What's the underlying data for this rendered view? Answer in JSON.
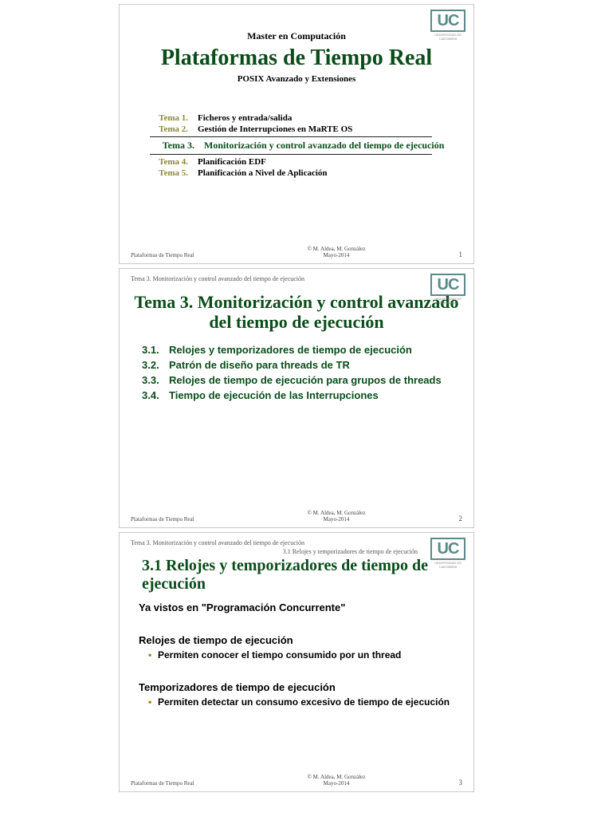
{
  "common": {
    "logo_text": "UC",
    "logo_sub": "UNIVERSIDAD DE CANTABRIA",
    "footer_left": "Plataformas de Tiempo Real",
    "footer_center1": "© M. Aldea, M. González",
    "footer_center2": "Mayo-2014"
  },
  "slide1": {
    "pretitle": "Master en Computación",
    "title": "Plataformas de Tiempo Real",
    "subtitle": "POSIX Avanzado y Extensiones",
    "toc": [
      {
        "num": "Tema 1.",
        "label": "Ficheros y entrada/salida"
      },
      {
        "num": "Tema 2.",
        "label": "Gestión de Interrupciones en MaRTE OS"
      }
    ],
    "toc_highlight": {
      "num": "Tema 3.",
      "label": "Monitorización y control avanzado del tiempo de ejecución"
    },
    "toc_after": [
      {
        "num": "Tema 4.",
        "label": "Planificación EDF"
      },
      {
        "num": "Tema 5.",
        "label": "Planificación a Nivel de Aplicación"
      }
    ],
    "page": "1"
  },
  "slide2": {
    "breadcrumb": "Tema 3. Monitorización y control avanzado del tiempo de ejecución",
    "title": "Tema 3. Monitorización y control avanzado del tiempo de ejecución",
    "sections": [
      {
        "num": "3.1.",
        "txt": "Relojes y temporizadores de tiempo de ejecución"
      },
      {
        "num": "3.2.",
        "txt": "Patrón de diseño para threads de TR"
      },
      {
        "num": "3.3.",
        "txt": "Relojes de tiempo de ejecución para grupos de threads"
      },
      {
        "num": "3.4.",
        "txt": "Tiempo de ejecución de las Interrupciones"
      }
    ],
    "page": "2"
  },
  "slide3": {
    "breadcrumb1": "Tema 3. Monitorización y control avanzado del tiempo de ejecución",
    "breadcrumb2": "3.1 Relojes y temporizadores de tiempo de ejecución",
    "title": "3.1   Relojes y temporizadores de tiempo de ejecución",
    "intro": "Ya vistos en \"Programación Concurrente\"",
    "h1": "Relojes de tiempo de ejecución",
    "b1": "Permiten conocer el tiempo consumido por un thread",
    "h2": "Temporizadores de tiempo de ejecución",
    "b2": "Permiten detectar un consumo excesivo de tiempo de ejecución",
    "page": "3"
  }
}
